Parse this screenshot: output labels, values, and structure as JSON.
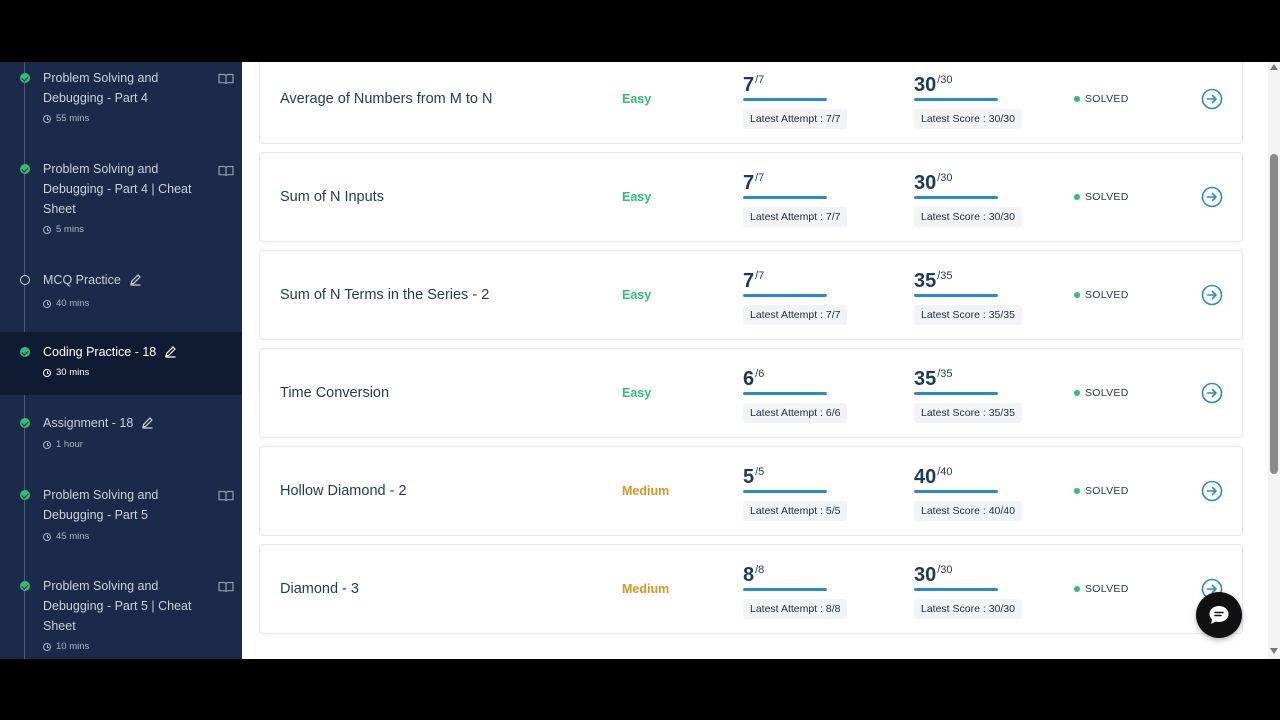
{
  "sidebar": {
    "items": [
      {
        "title": "Problem Solving and Debugging - Part 4",
        "duration": "55 mins",
        "status": "done",
        "icon": "book-icon",
        "active": false
      },
      {
        "title": "Problem Solving and Debugging - Part 4 | Cheat Sheet",
        "duration": "5 mins",
        "status": "done",
        "icon": "book-icon",
        "active": false
      },
      {
        "title": "MCQ Practice",
        "duration": "40 mins",
        "status": "empty",
        "icon": "pencil-icon",
        "active": false
      },
      {
        "title": "Coding Practice - 18",
        "duration": "30 mins",
        "status": "done",
        "icon": "pencil-icon",
        "active": true
      },
      {
        "title": "Assignment - 18",
        "duration": "1 hour",
        "status": "done",
        "icon": "pencil-icon",
        "active": false
      },
      {
        "title": "Problem Solving and Debugging - Part 5",
        "duration": "45 mins",
        "status": "done",
        "icon": "book-icon",
        "active": false
      },
      {
        "title": "Problem Solving and Debugging - Part 5 | Cheat Sheet",
        "duration": "10 mins",
        "status": "done",
        "icon": "book-icon",
        "active": false
      }
    ]
  },
  "questions": [
    {
      "title": "Average of Numbers from M to N",
      "difficulty": "Easy",
      "attempt_value": "7",
      "attempt_total": "/7",
      "attempt_label": "Latest Attempt : 7/7",
      "attempt_fraction": 1.0,
      "score_value": "30",
      "score_total": "/30",
      "score_label": "Latest Score : 30/30",
      "score_fraction": 1.0,
      "status": "SOLVED"
    },
    {
      "title": "Sum of N Inputs",
      "difficulty": "Easy",
      "attempt_value": "7",
      "attempt_total": "/7",
      "attempt_label": "Latest Attempt : 7/7",
      "attempt_fraction": 1.0,
      "score_value": "30",
      "score_total": "/30",
      "score_label": "Latest Score : 30/30",
      "score_fraction": 1.0,
      "status": "SOLVED"
    },
    {
      "title": "Sum of N Terms in the Series - 2",
      "difficulty": "Easy",
      "attempt_value": "7",
      "attempt_total": "/7",
      "attempt_label": "Latest Attempt : 7/7",
      "attempt_fraction": 1.0,
      "score_value": "35",
      "score_total": "/35",
      "score_label": "Latest Score : 35/35",
      "score_fraction": 1.0,
      "status": "SOLVED"
    },
    {
      "title": "Time Conversion",
      "difficulty": "Easy",
      "attempt_value": "6",
      "attempt_total": "/6",
      "attempt_label": "Latest Attempt : 6/6",
      "attempt_fraction": 1.0,
      "score_value": "35",
      "score_total": "/35",
      "score_label": "Latest Score : 35/35",
      "score_fraction": 1.0,
      "status": "SOLVED"
    },
    {
      "title": "Hollow Diamond - 2",
      "difficulty": "Medium",
      "attempt_value": "5",
      "attempt_total": "/5",
      "attempt_label": "Latest Attempt : 5/5",
      "attempt_fraction": 1.0,
      "score_value": "40",
      "score_total": "/40",
      "score_label": "Latest Score : 40/40",
      "score_fraction": 1.0,
      "status": "SOLVED"
    },
    {
      "title": "Diamond - 3",
      "difficulty": "Medium",
      "attempt_value": "8",
      "attempt_total": "/8",
      "attempt_label": "Latest Attempt : 8/8",
      "attempt_fraction": 1.0,
      "score_value": "30",
      "score_total": "/30",
      "score_label": "Latest Score : 30/30",
      "score_fraction": 1.0,
      "status": "SOLVED"
    }
  ],
  "colors": {
    "easy": "#2fbf71",
    "medium": "#d9961e",
    "solved": "#2fbf71",
    "progress": "#2a8bc4",
    "sidebar_bg": "#1b2a48"
  },
  "chat": {
    "icon": "chat-icon"
  }
}
